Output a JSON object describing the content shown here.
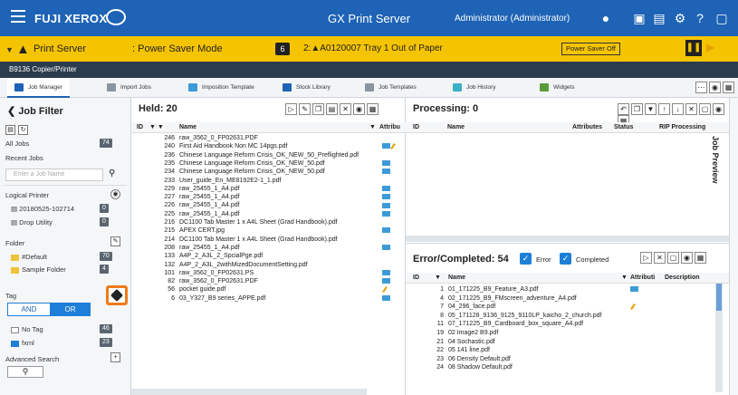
{
  "header": {
    "brand": "FUJI XEROX",
    "app_title": "GX Print Server",
    "user": "Administrator (Administrator)"
  },
  "status": {
    "server_label": "Print Server",
    "mode": ": Power Saver Mode",
    "count": "6",
    "message": "2:▲A0120007 Tray 1 Out of Paper",
    "power_saver_off": "Power Saver Off"
  },
  "printer_name": "B9136 Copier/Printer",
  "tabs": [
    {
      "label": "Job Manager",
      "color": "#1e63b5"
    },
    {
      "label": "Import Jobs",
      "color": "#8a95a0"
    },
    {
      "label": "Imposition Template",
      "color": "#3b9bd8"
    },
    {
      "label": "Stock Library",
      "color": "#1e63b5"
    },
    {
      "label": "Job Templates",
      "color": "#8a95a0"
    },
    {
      "label": "Job History",
      "color": "#3bb0c8"
    },
    {
      "label": "Widgets",
      "color": "#5a9a3a"
    }
  ],
  "job_filter": {
    "title": "Job Filter",
    "all_jobs": "All Jobs",
    "all_jobs_count": "74",
    "recent_jobs": "Recent Jobs",
    "job_name_placeholder": "Enter a Job Name",
    "logical_printer": "Logical Printer",
    "printers": [
      {
        "name": "20180525-102714",
        "badge": "0"
      },
      {
        "name": "Drop Utility",
        "badge": "0"
      }
    ],
    "folder": "Folder",
    "folders": [
      {
        "name": "#Default",
        "badge": "70"
      },
      {
        "name": "Sample Folder",
        "badge": "4"
      }
    ],
    "tag": "Tag",
    "and_label": "AND",
    "or_label": "OR",
    "tags": [
      {
        "name": "No Tag",
        "badge": "46"
      },
      {
        "name": "fxml",
        "badge": "23"
      }
    ],
    "advanced_search": "Advanced Search"
  },
  "held": {
    "title": "Held: 20",
    "col_id": "ID",
    "col_name": "Name",
    "col_attr": "Attribu",
    "rows": [
      {
        "id": "246",
        "name": "raw_3562_0_FP02631.PDF",
        "attr": ""
      },
      {
        "id": "240",
        "name": "First Aid Handbook Non MC 14pgs.pdf",
        "attr": "rip-pen"
      },
      {
        "id": "236",
        "name": "Chinese Language Reform Crisis_OK_NEW_50_Preflighted.pdf",
        "attr": ""
      },
      {
        "id": "235",
        "name": "Chinese Language Reform Crisis_OK_NEW_50.pdf",
        "attr": "rip"
      },
      {
        "id": "234",
        "name": "Chinese Language Reform Crisis_OK_NEW_50.pdf",
        "attr": "rip"
      },
      {
        "id": "233",
        "name": "User_guide_En_ME8192E2-1_1.pdf",
        "attr": ""
      },
      {
        "id": "229",
        "name": "raw_25455_1_A4.pdf",
        "attr": "rip"
      },
      {
        "id": "227",
        "name": "raw_25455_1_A4.pdf",
        "attr": "rip"
      },
      {
        "id": "226",
        "name": "raw_25455_1_A4.pdf",
        "attr": "rip"
      },
      {
        "id": "225",
        "name": "raw_25455_1_A4.pdf",
        "attr": "rip"
      },
      {
        "id": "216",
        "name": "DC1100 Tab Master 1 x A4L Sheet (Grad Handbook).pdf",
        "attr": ""
      },
      {
        "id": "215",
        "name": "APEX CERT.jpg",
        "attr": "rip"
      },
      {
        "id": "214",
        "name": "DC1100 Tab Master 1 x A4L Sheet (Grad Handbook).pdf",
        "attr": ""
      },
      {
        "id": "208",
        "name": "raw_25455_1_A4.pdf",
        "attr": "rip"
      },
      {
        "id": "133",
        "name": "A4P_2_A3L_2_SpcialPge.pdf",
        "attr": ""
      },
      {
        "id": "132",
        "name": "A4P_2_A3L_2withMizedDocumentSetting.pdf",
        "attr": ""
      },
      {
        "id": "101",
        "name": "raw_3562_0_FP02631.PS",
        "attr": "rip"
      },
      {
        "id": "82",
        "name": "raw_3562_0_FP02631.PDF",
        "attr": "rip"
      },
      {
        "id": "56",
        "name": "pocket guide.pdf",
        "attr": "pen"
      },
      {
        "id": "6",
        "name": "03_Y327_B9 series_APPE.pdf",
        "attr": "rip"
      }
    ]
  },
  "processing": {
    "title": "Processing: 0",
    "col_id": "ID",
    "col_name": "Name",
    "col_attr": "Attributes",
    "col_status": "Status",
    "col_rip": "RIP Processing"
  },
  "errors": {
    "title": "Error/Completed: 54",
    "error_label": "Error",
    "completed_label": "Completed",
    "col_id": "ID",
    "col_name": "Name",
    "col_attr": "Attributi",
    "col_desc": "Description",
    "rows": [
      {
        "id": "1",
        "name": "01_171225_B9_Feature_A3.pdf",
        "attr": "rip"
      },
      {
        "id": "4",
        "name": "02_171225_B9_FMscreen_adventure_A4.pdf",
        "attr": ""
      },
      {
        "id": "7",
        "name": "04_296_face.pdf",
        "attr": "pen"
      },
      {
        "id": "8",
        "name": "05_171128_9136_9125_9110LP_kaicho_2_church.pdf",
        "attr": ""
      },
      {
        "id": "11",
        "name": "07_171225_B9_Cardboard_box_square_A4.pdf",
        "attr": ""
      },
      {
        "id": "19",
        "name": "02 Image2 B9.pdf",
        "attr": ""
      },
      {
        "id": "21",
        "name": "04 Sochastic.pdf",
        "attr": ""
      },
      {
        "id": "22",
        "name": "05 141 line.pdf",
        "attr": ""
      },
      {
        "id": "23",
        "name": "06 Density Default.pdf",
        "attr": ""
      },
      {
        "id": "24",
        "name": "08 Shadow Default.pdf",
        "attr": ""
      }
    ]
  },
  "preview_label": "Job Preview",
  "colors": {
    "brand_blue": "#1e63b5",
    "alert_yellow": "#f5c400",
    "accent_orange": "#f07a1a"
  }
}
